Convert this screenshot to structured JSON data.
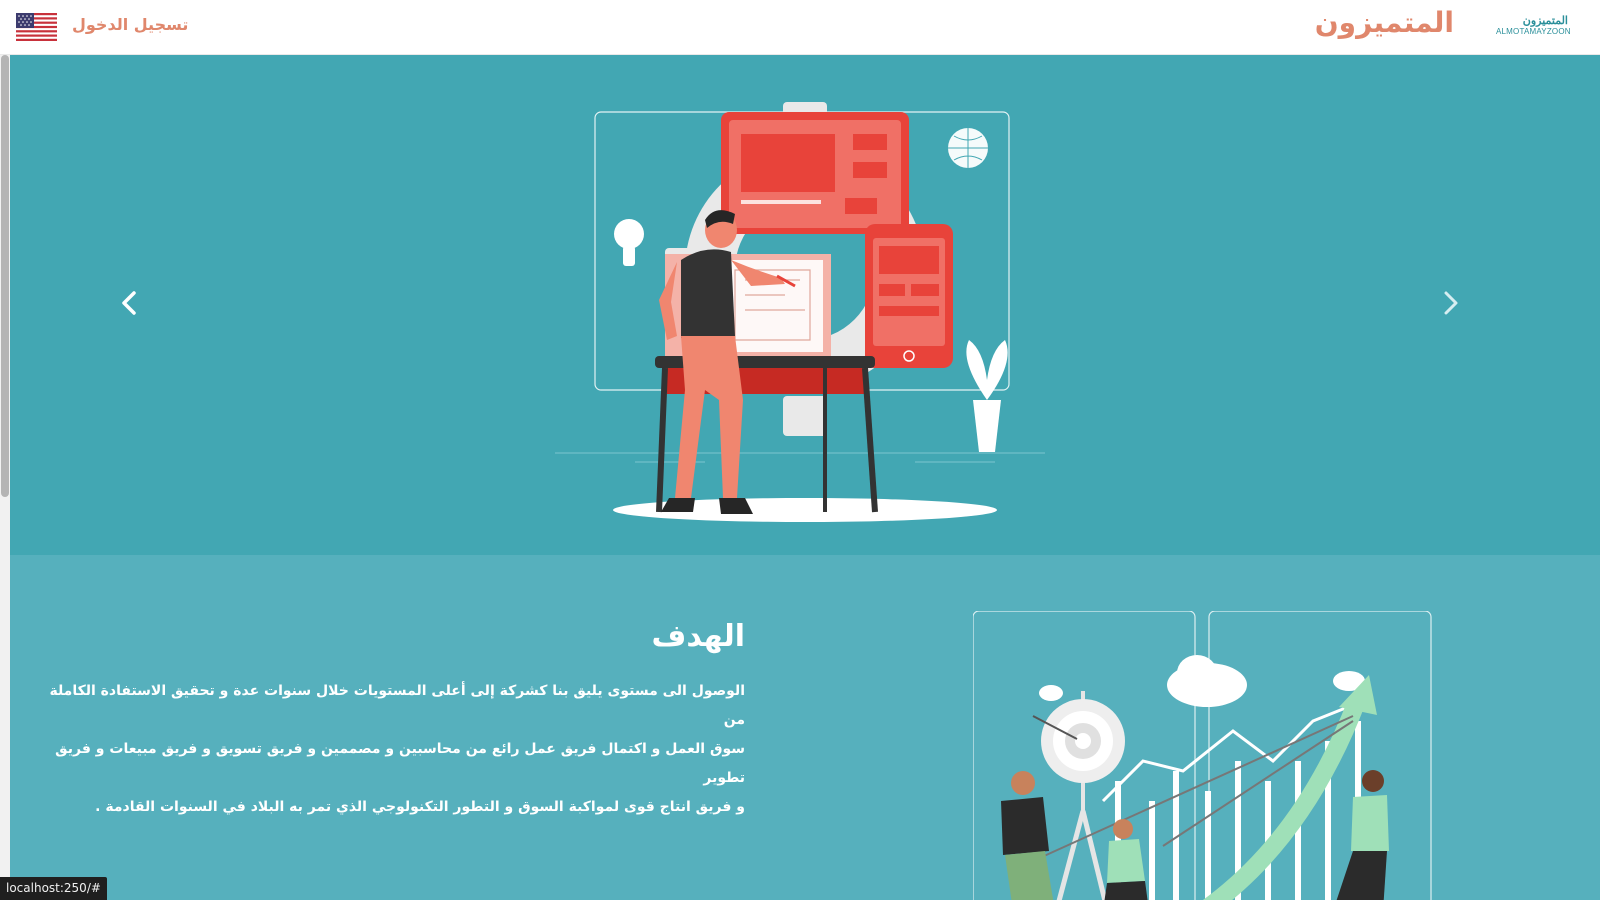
{
  "header": {
    "brand_name": "المتميزون",
    "logo_text_ar": "المتميزون",
    "logo_text_en": "ALMOTAMAYZOON",
    "login_label": "تسجيل الدخول",
    "language_flag": "us-flag-icon"
  },
  "hero": {
    "prev_icon": "chevron-left-icon",
    "next_icon": "chevron-right-icon",
    "illustration": "designer-workspace-illustration"
  },
  "goal": {
    "title": "الهدف",
    "lines": [
      "الوصول الى مستوى يليق بنا كشركة إلى أعلى المستويات خلال سنوات عدة و تحقيق الاستفادة الكاملة من",
      "سوق العمل و اكتمال فريق عمل رائع من محاسبين و مصممين و فريق تسويق و فريق مبيعات و فريق تطوير",
      "و فريق انتاج قوى لمواكبة السوق و التطور التكنولوجي الذي تمر به البلاد في السنوات القادمة ."
    ],
    "illustration": "team-growth-target-illustration"
  },
  "statusbar": {
    "url": "localhost:250/#"
  },
  "colors": {
    "brand_accent": "#e0876c",
    "hero_bg": "#42a7b3",
    "goal_bg": "#56b0bd",
    "illustration_red": "#e8433a"
  }
}
